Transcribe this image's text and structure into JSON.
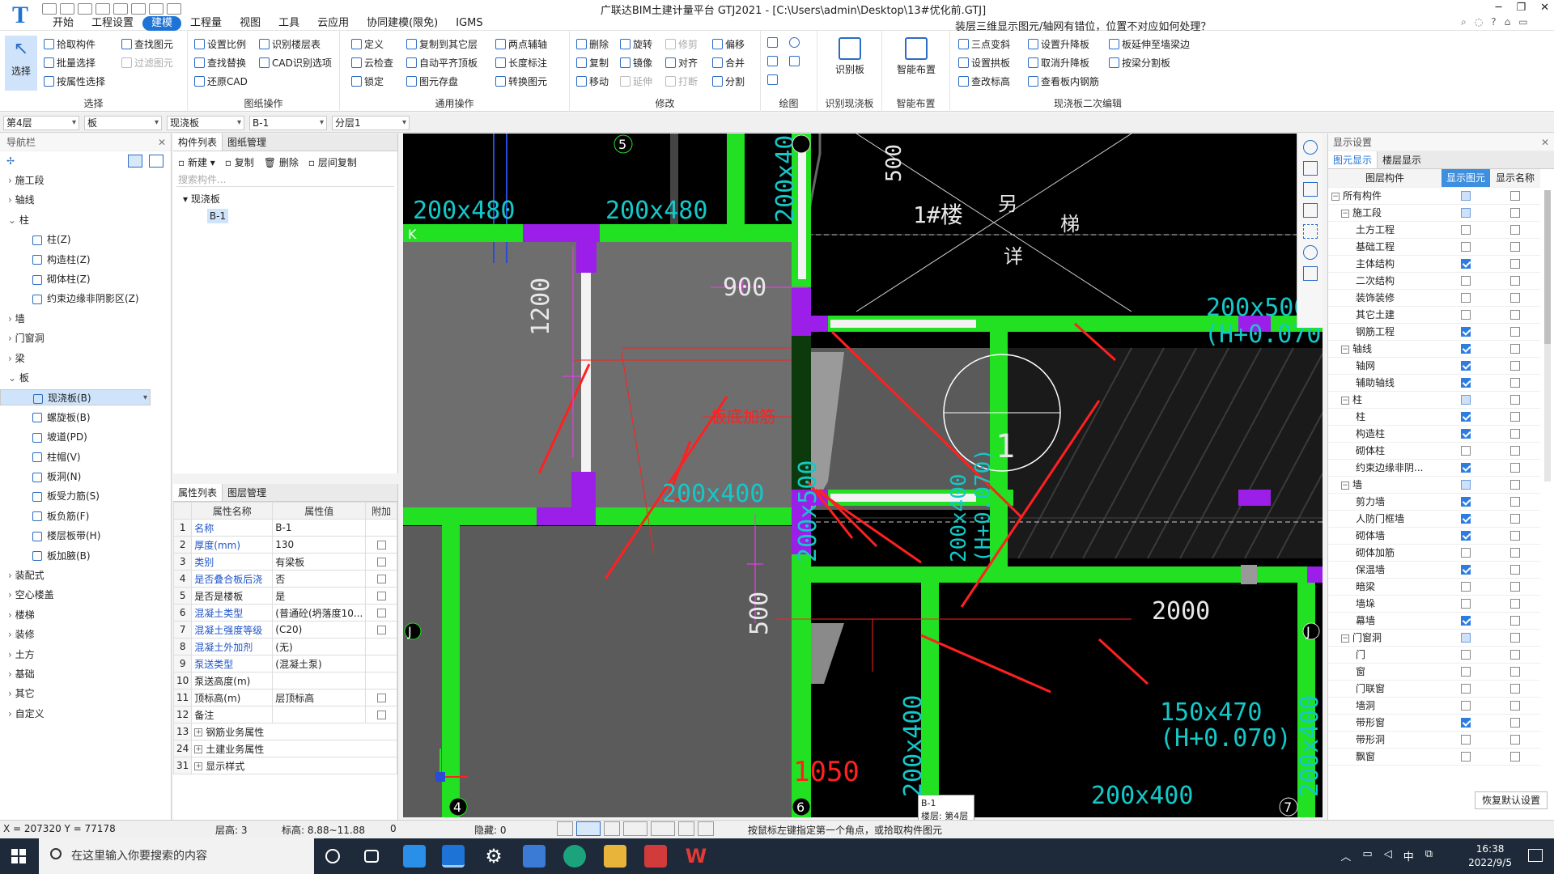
{
  "app": {
    "title": "广联达BIM土建计量平台 GTJ2021 - [C:\\Users\\admin\\Desktop\\13#优化前.GTJ]",
    "logo": "T"
  },
  "menus": [
    "开始",
    "工程设置",
    "建模",
    "工程量",
    "视图",
    "工具",
    "云应用",
    "协同建模(限免)",
    "IGMS"
  ],
  "active_menu": "建模",
  "help_question": "装层三维显示图元/轴网有错位，位置不对应如何处理？",
  "ribbon": {
    "select": {
      "big": "选择",
      "items": [
        "拾取构件",
        "批量选择",
        "按属性选择",
        "查找图元",
        "过滤图元"
      ],
      "label": "选择"
    },
    "drawing": {
      "items": [
        "设置比例",
        "识别楼层表",
        "查找替换",
        "CAD识别选项",
        "还原CAD"
      ],
      "label": "图纸操作"
    },
    "general": {
      "items": [
        "定义",
        "复制到其它层",
        "两点辅轴",
        "云检查",
        "自动平齐顶板",
        "长度标注",
        "锁定",
        "图元存盘",
        "转换图元"
      ],
      "label": "通用操作"
    },
    "modify": {
      "items": [
        "删除",
        "旋转",
        "修剪",
        "偏移",
        "复制",
        "镜像",
        "对齐",
        "合并",
        "移动",
        "延伸",
        "打断",
        "分割"
      ],
      "label": "修改"
    },
    "draw": {
      "label": "绘图"
    },
    "recognize": {
      "big": "识别板",
      "label": "识别现浇板"
    },
    "smart": {
      "big": "智能布置",
      "label": "智能布置"
    },
    "edit2": {
      "items": [
        "三点变斜",
        "设置升降板",
        "板延伸至墙梁边",
        "设置拱板",
        "取消升降板",
        "按梁分割板",
        "查改标高",
        "查看板内钢筋"
      ],
      "label": "现浇板二次编辑"
    }
  },
  "selectors": [
    "第4层",
    "板",
    "现浇板",
    "B-1",
    "分层1"
  ],
  "nav": {
    "title": "导航栏",
    "items": [
      {
        "label": "施工段",
        "level": 0,
        "exp": "›"
      },
      {
        "label": "轴线",
        "level": 0,
        "exp": "›"
      },
      {
        "label": "柱",
        "level": 0,
        "exp": "⌄"
      },
      {
        "label": "柱(Z)",
        "level": 1
      },
      {
        "label": "构造柱(Z)",
        "level": 1
      },
      {
        "label": "砌体柱(Z)",
        "level": 1
      },
      {
        "label": "约束边缘非阴影区(Z)",
        "level": 1
      },
      {
        "label": "墙",
        "level": 0,
        "exp": "›"
      },
      {
        "label": "门窗洞",
        "level": 0,
        "exp": "›"
      },
      {
        "label": "梁",
        "level": 0,
        "exp": "›"
      },
      {
        "label": "板",
        "level": 0,
        "exp": "⌄"
      },
      {
        "label": "现浇板(B)",
        "level": 1,
        "selected": true
      },
      {
        "label": "螺旋板(B)",
        "level": 1
      },
      {
        "label": "坡道(PD)",
        "level": 1
      },
      {
        "label": "柱帽(V)",
        "level": 1
      },
      {
        "label": "板洞(N)",
        "level": 1
      },
      {
        "label": "板受力筋(S)",
        "level": 1
      },
      {
        "label": "板负筋(F)",
        "level": 1
      },
      {
        "label": "楼层板带(H)",
        "level": 1
      },
      {
        "label": "板加腋(B)",
        "level": 1
      },
      {
        "label": "装配式",
        "level": 0,
        "exp": "›"
      },
      {
        "label": "空心楼盖",
        "level": 0,
        "exp": "›"
      },
      {
        "label": "楼梯",
        "level": 0,
        "exp": "›"
      },
      {
        "label": "装修",
        "level": 0,
        "exp": "›"
      },
      {
        "label": "土方",
        "level": 0,
        "exp": "›"
      },
      {
        "label": "基础",
        "level": 0,
        "exp": "›"
      },
      {
        "label": "其它",
        "level": 0,
        "exp": "›"
      },
      {
        "label": "自定义",
        "level": 0,
        "exp": "›"
      }
    ]
  },
  "component_list": {
    "tabs": [
      "构件列表",
      "图纸管理"
    ],
    "toolbar": [
      "新建",
      "复制",
      "删除",
      "层间复制"
    ],
    "search_placeholder": "搜索构件...",
    "group": "现浇板",
    "item": "B-1"
  },
  "properties": {
    "tabs": [
      "属性列表",
      "图层管理"
    ],
    "headers": [
      "属性名称",
      "属性值",
      "附加"
    ],
    "rows": [
      {
        "n": "1",
        "k": "名称",
        "v": "B-1",
        "blue": true,
        "cb": false
      },
      {
        "n": "2",
        "k": "厚度(mm)",
        "v": "130",
        "blue": true,
        "cb": true
      },
      {
        "n": "3",
        "k": "类别",
        "v": "有梁板",
        "blue": true,
        "cb": true
      },
      {
        "n": "4",
        "k": "是否叠合板后浇",
        "v": "否",
        "blue": true,
        "cb": true
      },
      {
        "n": "5",
        "k": "是否是楼板",
        "v": "是",
        "blue": false,
        "cb": true
      },
      {
        "n": "6",
        "k": "混凝土类型",
        "v": "(普通砼(坍落度10...",
        "blue": true,
        "cb": true
      },
      {
        "n": "7",
        "k": "混凝土强度等级",
        "v": "(C20)",
        "blue": true,
        "cb": true
      },
      {
        "n": "8",
        "k": "混凝土外加剂",
        "v": "(无)",
        "blue": true,
        "cb": false
      },
      {
        "n": "9",
        "k": "泵送类型",
        "v": "(混凝土泵)",
        "blue": true,
        "cb": false
      },
      {
        "n": "10",
        "k": "泵送高度(m)",
        "v": "",
        "blue": false,
        "cb": false
      },
      {
        "n": "11",
        "k": "顶标高(m)",
        "v": "层顶标高",
        "blue": false,
        "cb": true
      },
      {
        "n": "12",
        "k": "备注",
        "v": "",
        "blue": false,
        "cb": true
      },
      {
        "n": "13",
        "k": "钢筋业务属性",
        "v": "",
        "blue": false,
        "cb": false,
        "expand": true
      },
      {
        "n": "24",
        "k": "土建业务属性",
        "v": "",
        "blue": false,
        "cb": false,
        "expand": true
      },
      {
        "n": "31",
        "k": "显示样式",
        "v": "",
        "blue": false,
        "cb": false,
        "expand": true
      }
    ]
  },
  "display": {
    "title": "显示设置",
    "tabs": [
      "图元显示",
      "楼层显示"
    ],
    "headers": [
      "图层构件",
      "显示图元",
      "显示名称"
    ],
    "restore": "恢复默认设置",
    "rows": [
      {
        "label": "所有构件",
        "level": 0,
        "exp": "−",
        "show": "part",
        "name": false
      },
      {
        "label": "施工段",
        "level": 1,
        "exp": "−",
        "show": "part",
        "name": false
      },
      {
        "label": "土方工程",
        "level": 2,
        "show": false,
        "name": false
      },
      {
        "label": "基础工程",
        "level": 2,
        "show": false,
        "name": false
      },
      {
        "label": "主体结构",
        "level": 2,
        "show": true,
        "name": false
      },
      {
        "label": "二次结构",
        "level": 2,
        "show": false,
        "name": false
      },
      {
        "label": "装饰装修",
        "level": 2,
        "show": false,
        "name": false
      },
      {
        "label": "其它土建",
        "level": 2,
        "show": false,
        "name": false
      },
      {
        "label": "钢筋工程",
        "level": 2,
        "show": true,
        "name": false
      },
      {
        "label": "轴线",
        "level": 1,
        "exp": "−",
        "show": true,
        "name": false
      },
      {
        "label": "轴网",
        "level": 2,
        "show": true,
        "name": false
      },
      {
        "label": "辅助轴线",
        "level": 2,
        "show": true,
        "name": false
      },
      {
        "label": "柱",
        "level": 1,
        "exp": "−",
        "show": "part",
        "name": false
      },
      {
        "label": "柱",
        "level": 2,
        "show": true,
        "name": false
      },
      {
        "label": "构造柱",
        "level": 2,
        "show": true,
        "name": false
      },
      {
        "label": "砌体柱",
        "level": 2,
        "show": false,
        "name": false
      },
      {
        "label": "约束边缘非阴...",
        "level": 2,
        "show": true,
        "name": false
      },
      {
        "label": "墙",
        "level": 1,
        "exp": "−",
        "show": "part",
        "name": false
      },
      {
        "label": "剪力墙",
        "level": 2,
        "show": true,
        "name": false
      },
      {
        "label": "人防门框墙",
        "level": 2,
        "show": true,
        "name": false
      },
      {
        "label": "砌体墙",
        "level": 2,
        "show": true,
        "name": false
      },
      {
        "label": "砌体加筋",
        "level": 2,
        "show": false,
        "name": false
      },
      {
        "label": "保温墙",
        "level": 2,
        "show": true,
        "name": false
      },
      {
        "label": "暗梁",
        "level": 2,
        "show": false,
        "name": false
      },
      {
        "label": "墙垛",
        "level": 2,
        "show": false,
        "name": false
      },
      {
        "label": "幕墙",
        "level": 2,
        "show": true,
        "name": false
      },
      {
        "label": "门窗洞",
        "level": 1,
        "exp": "−",
        "show": "part",
        "name": false
      },
      {
        "label": "门",
        "level": 2,
        "show": false,
        "name": false
      },
      {
        "label": "窗",
        "level": 2,
        "show": false,
        "name": false
      },
      {
        "label": "门联窗",
        "level": 2,
        "show": false,
        "name": false
      },
      {
        "label": "墙洞",
        "level": 2,
        "show": false,
        "name": false
      },
      {
        "label": "带形窗",
        "level": 2,
        "show": true,
        "name": false
      },
      {
        "label": "带形洞",
        "level": 2,
        "show": false,
        "name": false
      },
      {
        "label": "飘窗",
        "level": 2,
        "show": false,
        "name": false
      }
    ]
  },
  "canvas": {
    "dims": [
      "200x480",
      "200x480",
      "200x400",
      "200x500",
      "200x500",
      "200x400",
      "150x470",
      "200x400",
      "200x400",
      "2000",
      "1200",
      "900",
      "500",
      "1050",
      "500",
      "200x400",
      "(H+0.070)",
      "(H+0.070)",
      "(H+0.070)",
      "1#楼",
      "另",
      "详",
      "梯",
      "1",
      "板底加筋"
    ],
    "axes": [
      "5",
      "6",
      "4",
      "7",
      "K",
      "J",
      "J"
    ],
    "tooltip_name": "B-1",
    "tooltip_floor": "楼层: 第4层"
  },
  "status": {
    "coords": "X = 207320 Y = 77178",
    "floor_h": "层高:  3",
    "elev": "标高:  8.88~11.88",
    "zero": "0",
    "hidden": "隐藏:  0",
    "hint": "按鼠标左键指定第一个角点，或拾取构件图元"
  },
  "taskbar": {
    "search": "在这里输入你要搜索的内容",
    "time": "16:38",
    "date": "2022/9/5",
    "ime": "中"
  },
  "colors": {
    "accent": "#1e73d6",
    "beam": "#22e022",
    "column": "#9b1fe8",
    "dim_text": "#14c8c8",
    "annotation_red": "#ff2020"
  }
}
